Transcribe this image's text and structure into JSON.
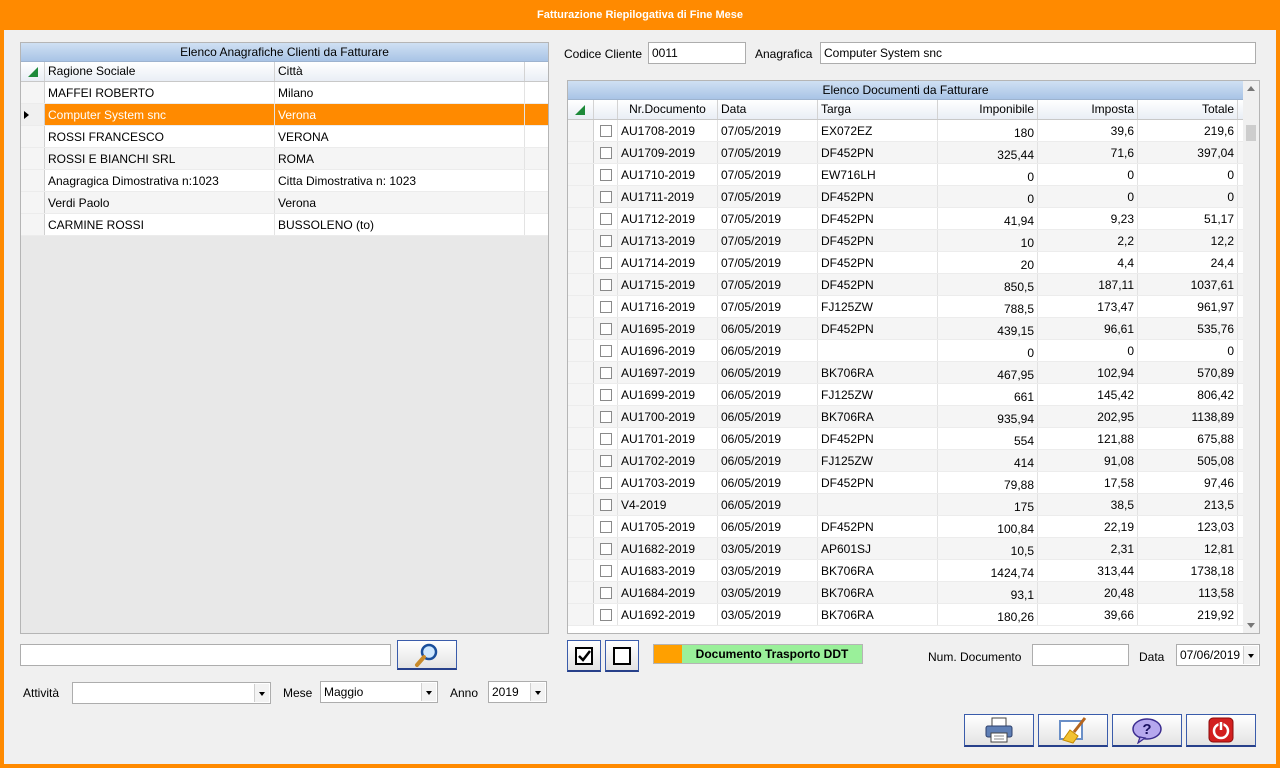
{
  "window": {
    "title": "Fatturazione Riepilogativa di Fine Mese"
  },
  "clients": {
    "caption": "Elenco Anagrafiche Clienti da Fatturare",
    "columns": [
      "Ragione Sociale",
      "Città"
    ],
    "rows": [
      [
        "MAFFEI ROBERTO",
        "Milano"
      ],
      [
        "Computer System snc",
        "Verona"
      ],
      [
        "ROSSI FRANCESCO",
        "VERONA"
      ],
      [
        "ROSSI E BIANCHI SRL",
        "ROMA"
      ],
      [
        "Anagragica Dimostrativa n:1023",
        "Citta Dimostrativa n: 1023"
      ],
      [
        "Verdi Paolo",
        "Verona"
      ],
      [
        "CARMINE ROSSI",
        "BUSSOLENO (to)"
      ]
    ],
    "selected_index": 1
  },
  "search": {
    "value": ""
  },
  "filters": {
    "attivita_label": "Attività",
    "attivita_value": "",
    "mese_label": "Mese",
    "mese_value": "Maggio",
    "anno_label": "Anno",
    "anno_value": "2019"
  },
  "header": {
    "codice_label": "Codice Cliente",
    "codice_value": "0011",
    "anagrafica_label": "Anagrafica",
    "anagrafica_value": "Computer System snc"
  },
  "documents": {
    "caption": "Elenco Documenti da Fatturare",
    "columns": [
      "Nr.Documento",
      "Data",
      "Targa",
      "Imponibile",
      "Imposta",
      "Totale"
    ],
    "rows": [
      [
        "AU1708-2019",
        "07/05/2019",
        "EX072EZ",
        "180",
        "39,6",
        "219,6"
      ],
      [
        "AU1709-2019",
        "07/05/2019",
        "DF452PN",
        "325,44",
        "71,6",
        "397,04"
      ],
      [
        "AU1710-2019",
        "07/05/2019",
        "EW716LH",
        "0",
        "0",
        "0"
      ],
      [
        "AU1711-2019",
        "07/05/2019",
        "DF452PN",
        "0",
        "0",
        "0"
      ],
      [
        "AU1712-2019",
        "07/05/2019",
        "DF452PN",
        "41,94",
        "9,23",
        "51,17"
      ],
      [
        "AU1713-2019",
        "07/05/2019",
        "DF452PN",
        "10",
        "2,2",
        "12,2"
      ],
      [
        "AU1714-2019",
        "07/05/2019",
        "DF452PN",
        "20",
        "4,4",
        "24,4"
      ],
      [
        "AU1715-2019",
        "07/05/2019",
        "DF452PN",
        "850,5",
        "187,11",
        "1037,61"
      ],
      [
        "AU1716-2019",
        "07/05/2019",
        "FJ125ZW",
        "788,5",
        "173,47",
        "961,97"
      ],
      [
        "AU1695-2019",
        "06/05/2019",
        "DF452PN",
        "439,15",
        "96,61",
        "535,76"
      ],
      [
        "AU1696-2019",
        "06/05/2019",
        "",
        "0",
        "0",
        "0"
      ],
      [
        "AU1697-2019",
        "06/05/2019",
        "BK706RA",
        "467,95",
        "102,94",
        "570,89"
      ],
      [
        "AU1699-2019",
        "06/05/2019",
        "FJ125ZW",
        "661",
        "145,42",
        "806,42"
      ],
      [
        "AU1700-2019",
        "06/05/2019",
        "BK706RA",
        "935,94",
        "202,95",
        "1138,89"
      ],
      [
        "AU1701-2019",
        "06/05/2019",
        "DF452PN",
        "554",
        "121,88",
        "675,88"
      ],
      [
        "AU1702-2019",
        "06/05/2019",
        "FJ125ZW",
        "414",
        "91,08",
        "505,08"
      ],
      [
        "AU1703-2019",
        "06/05/2019",
        "DF452PN",
        "79,88",
        "17,58",
        "97,46"
      ],
      [
        "V4-2019",
        "06/05/2019",
        "",
        "175",
        "38,5",
        "213,5"
      ],
      [
        "AU1705-2019",
        "06/05/2019",
        "DF452PN",
        "100,84",
        "22,19",
        "123,03"
      ],
      [
        "AU1682-2019",
        "03/05/2019",
        "AP601SJ",
        "10,5",
        "2,31",
        "12,81"
      ],
      [
        "AU1683-2019",
        "03/05/2019",
        "BK706RA",
        "1424,74",
        "313,44",
        "1738,18"
      ],
      [
        "AU1684-2019",
        "03/05/2019",
        "BK706RA",
        "93,1",
        "20,48",
        "113,58"
      ],
      [
        "AU1692-2019",
        "03/05/2019",
        "BK706RA",
        "180,26",
        "39,66",
        "219,92"
      ]
    ]
  },
  "legend": {
    "label": "Documento Trasporto DDT",
    "swatch_color": "#ffa000",
    "bg_color": "#9af09a"
  },
  "bottom": {
    "num_documento_label": "Num. Documento",
    "num_documento_value": "",
    "data_label": "Data",
    "data_value": "07/06/2019"
  },
  "actions": [
    {
      "name": "print-icon"
    },
    {
      "name": "broom-icon"
    },
    {
      "name": "help-icon"
    },
    {
      "name": "power-icon"
    }
  ],
  "colors": {
    "accent": "#ff8a00",
    "header_blue": "#a9c4e6"
  }
}
